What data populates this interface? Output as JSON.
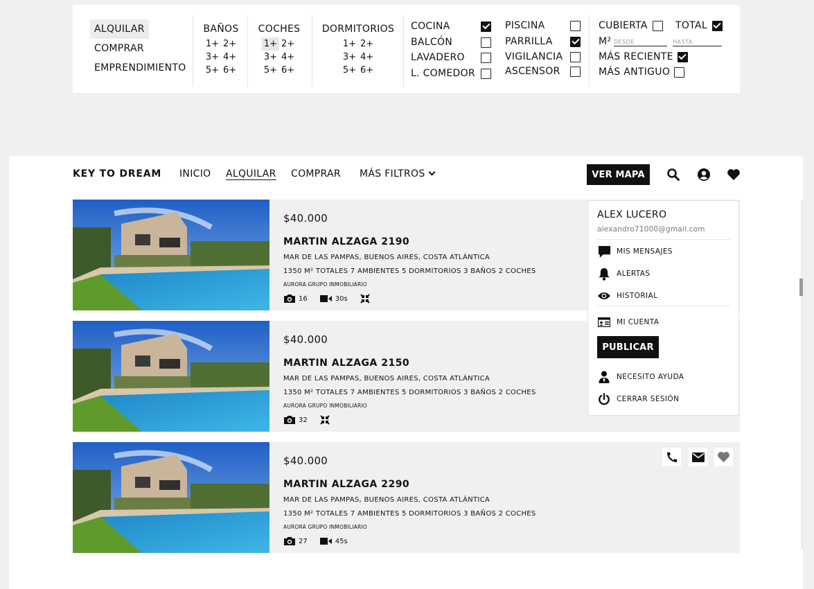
{
  "filters": {
    "operation": {
      "options": [
        "ALQUILAR",
        "COMPRAR",
        "EMPRENDIMIENTO"
      ],
      "selected": "ALQUILAR"
    },
    "banos": {
      "label": "BAÑOS",
      "rows": [
        [
          "1+",
          "2+"
        ],
        [
          "3+",
          "4+"
        ],
        [
          "5+",
          "6+"
        ]
      ]
    },
    "coches": {
      "label": "COCHES",
      "rows": [
        [
          "1+",
          "2+"
        ],
        [
          "3+",
          "4+"
        ],
        [
          "5+",
          "6+"
        ]
      ],
      "selected": "1+"
    },
    "dormitorios": {
      "label": "DORMITORIOS",
      "rows": [
        [
          "1+",
          "2+"
        ],
        [
          "3+",
          "4+"
        ],
        [
          "5+",
          "6+"
        ]
      ]
    },
    "amenities": [
      {
        "label": "COCINA",
        "checked": true
      },
      {
        "label": "BALCÓN",
        "checked": false
      },
      {
        "label": "LAVADERO",
        "checked": false
      },
      {
        "label": "L. COMEDOR",
        "checked": false
      },
      {
        "label": "PISCINA",
        "checked": false
      },
      {
        "label": "PARRILLA",
        "checked": true
      },
      {
        "label": "VIGILANCIA",
        "checked": false
      },
      {
        "label": "ASCENSOR",
        "checked": false
      }
    ],
    "cubierta": {
      "label": "CUBIERTA",
      "checked": false
    },
    "total": {
      "label": "TOTAL",
      "checked": true
    },
    "m2": {
      "label": "M²",
      "desde": "DESDE",
      "hasta": "HASTA"
    },
    "sort": [
      {
        "label": "MÁS RECIENTE",
        "checked": true
      },
      {
        "label": "MÁS ANTIGUO",
        "checked": false
      }
    ]
  },
  "navbar": {
    "brand": "KEY TO DREAM",
    "items": [
      "INICIO",
      "ALQUILAR",
      "COMPRAR",
      "MÁS FILTROS"
    ],
    "active": "ALQUILAR",
    "map_button": "VER MAPA",
    "icons": [
      "search-icon",
      "user-circle-icon",
      "heart-icon"
    ]
  },
  "user_menu": {
    "name": "ALEX LUCERO",
    "email": "alexandro71000@gmail.com",
    "items": [
      {
        "label": "MIS MENSAJES",
        "icon": "message-icon"
      },
      {
        "label": "ALERTAS",
        "icon": "bell-icon"
      },
      {
        "label": "HISTORIAL",
        "icon": "eye-icon"
      },
      {
        "label": "MI CUENTA",
        "icon": "id-card-icon"
      },
      {
        "label": "NECESITO AYUDA",
        "icon": "user-tie-icon"
      },
      {
        "label": "CERRAR SESIÓN",
        "icon": "power-icon"
      }
    ],
    "publish_button": "PUBLICAR"
  },
  "listings": [
    {
      "price": "$40.000",
      "title": "MARTIN ALZAGA 2190",
      "address": "MAR DE LAS PAMPAS, BUENOS AIRES, COSTA ATLÁNTICA",
      "specs": "1350 M² TOTALES 7 AMBIENTES 5 DORMITORIOS 3 BAÑOS 2 COCHES",
      "agency": "AURORA GRUPO INMOBILIARIO",
      "photos": "16",
      "video": "30s",
      "has_360": true
    },
    {
      "price": "$40.000",
      "title": "MARTIN ALZAGA 2150",
      "address": "MAR DE LAS PAMPAS, BUENOS AIRES, COSTA ATLÁNTICA",
      "specs": "1350 M² TOTALES 7 AMBIENTES 5 DORMITORIOS 3 BAÑOS 2 COCHES",
      "agency": "AURORA GRUPO INMOBILIARIO",
      "photos": "32",
      "has_360": true
    },
    {
      "price": "$40.000",
      "title": "MARTIN ALZAGA 2290",
      "address": "MAR DE LAS PAMPAS, BUENOS AIRES, COSTA ATLÁNTICA",
      "specs": "1350 M² TOTALES 7 AMBIENTES 5 DORMITORIOS 3 BAÑOS 2 COCHES",
      "agency": "AURORA GRUPO INMOBILIARIO",
      "photos": "27",
      "video": "45s",
      "actions": [
        "phone-icon",
        "envelope-icon",
        "heart-icon"
      ]
    }
  ],
  "colors": {
    "accent": "#111111",
    "panel": "#f0f0f0",
    "selected": "#ececec"
  }
}
